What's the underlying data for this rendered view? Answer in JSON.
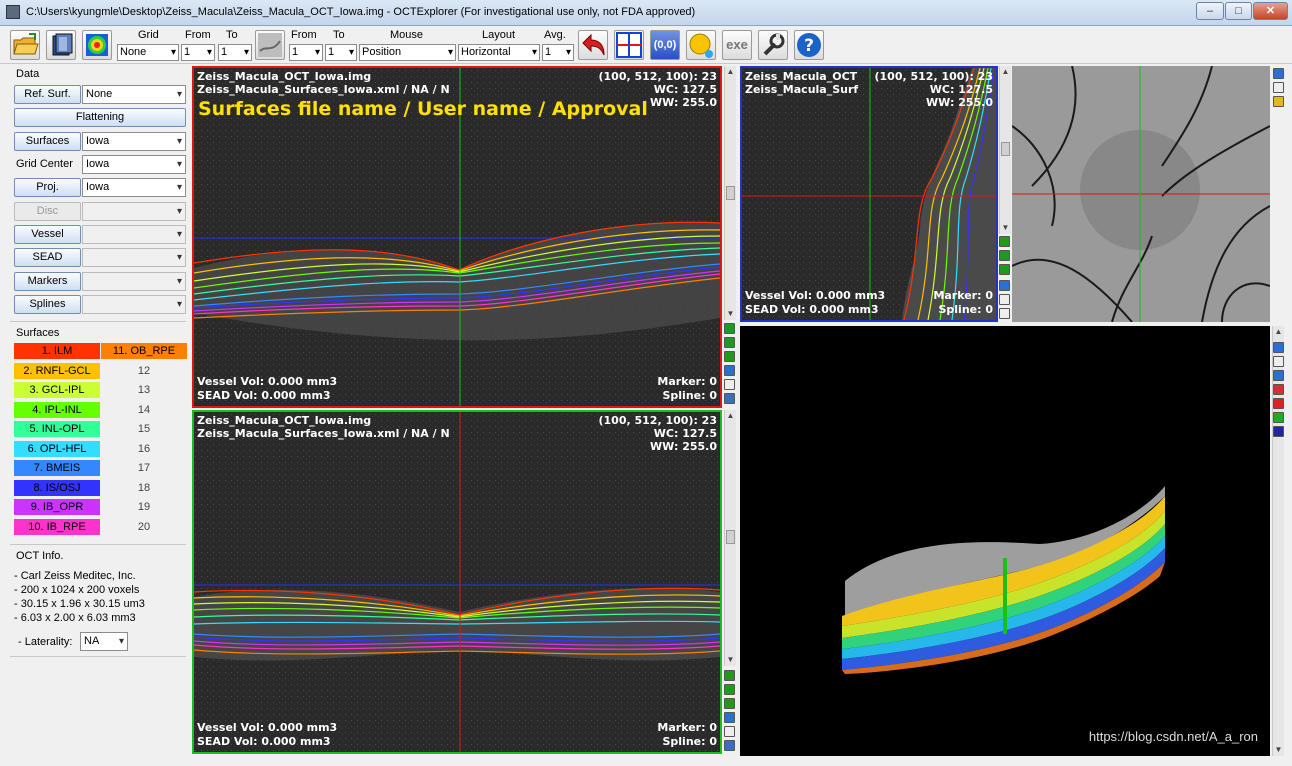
{
  "window": {
    "title": "C:\\Users\\kyungmle\\Desktop\\Zeiss_Macula\\Zeiss_Macula_OCT_Iowa.img - OCTExplorer (For investigational use only, not FDA approved)",
    "minimize": "‒",
    "maximize": "□",
    "close": "✕"
  },
  "toolbar": {
    "grid_label": "Grid",
    "grid_value": "None",
    "from1_label": "From",
    "from1_value": "1",
    "to1_label": "To",
    "to1_value": "1",
    "from2_label": "From",
    "from2_value": "1",
    "to2_label": "To",
    "to2_value": "1",
    "mouse_label": "Mouse",
    "mouse_value": "Position",
    "layout_label": "Layout",
    "layout_value": "Horizontal",
    "avg_label": "Avg.",
    "avg_value": "1",
    "coords_label": "(0,0)",
    "exe_label": "exe",
    "help_label": "?"
  },
  "sidebar": {
    "data_header": "Data",
    "ref_surf_btn": "Ref. Surf.",
    "ref_surf_value": "None",
    "flattening_btn": "Flattening",
    "surfaces_btn": "Surfaces",
    "surfaces_value": "Iowa",
    "grid_center_label": "Grid Center",
    "grid_center_value": "Iowa",
    "proj_btn": "Proj.",
    "proj_value": "Iowa",
    "disc_btn": "Disc",
    "vessel_btn": "Vessel",
    "sead_btn": "SEAD",
    "markers_btn": "Markers",
    "splines_btn": "Splines",
    "surfaces_header": "Surfaces",
    "surfaces_list": [
      {
        "label": "1. ILM",
        "color": "#ff3300"
      },
      {
        "label": "2. RNFL-GCL",
        "color": "#ffc000"
      },
      {
        "label": "3. GCL-IPL",
        "color": "#ccff33"
      },
      {
        "label": "4. IPL-INL",
        "color": "#66ff00"
      },
      {
        "label": "5. INL-OPL",
        "color": "#33ff99"
      },
      {
        "label": "6. OPL-HFL",
        "color": "#33ddff"
      },
      {
        "label": "7. BMEIS",
        "color": "#3388ff"
      },
      {
        "label": "8. IS/OSJ",
        "color": "#3333ff"
      },
      {
        "label": "9. IB_OPR",
        "color": "#cc33ff"
      },
      {
        "label": "10. IB_RPE",
        "color": "#ff33cc"
      }
    ],
    "surfaces_list2": [
      {
        "label": "11. OB_RPE",
        "color": "#ff8000"
      },
      {
        "label": "12"
      },
      {
        "label": "13"
      },
      {
        "label": "14"
      },
      {
        "label": "15"
      },
      {
        "label": "16"
      },
      {
        "label": "17"
      },
      {
        "label": "18"
      },
      {
        "label": "19"
      },
      {
        "label": "20"
      }
    ],
    "oct_info_header": "OCT Info.",
    "oct_info": [
      "- Carl Zeiss Meditec, Inc.",
      "- 200 x 1024 x 200 voxels",
      "- 30.15 x 1.96 x 30.15 um3",
      "- 6.03 x 2.00 x 6.03 mm3"
    ],
    "laterality_label": "- Laterality:",
    "laterality_value": "NA"
  },
  "panel_top": {
    "line1": "Zeiss_Macula_OCT_Iowa.img",
    "line2": "Zeiss_Macula_Surfaces_Iowa.xml / NA / N",
    "big_text": "Surfaces file name / User name / Approval",
    "coord": "(100, 512, 100): 23",
    "wc": "WC: 127.5",
    "ww": "WW: 255.0",
    "vessel": "Vessel Vol: 0.000 mm3",
    "sead": "SEAD Vol: 0.000 mm3",
    "marker": "Marker: 0",
    "spline": "Spline: 0"
  },
  "panel_bottom": {
    "line1": "Zeiss_Macula_OCT_Iowa.img",
    "line2": "Zeiss_Macula_Surfaces_Iowa.xml / NA / N",
    "coord": "(100, 512, 100): 23",
    "wc": "WC: 127.5",
    "ww": "WW: 255.0",
    "vessel": "Vessel Vol: 0.000 mm3",
    "sead": "SEAD Vol: 0.000 mm3",
    "marker": "Marker: 0",
    "spline": "Spline: 0"
  },
  "panel_side": {
    "line1": "Zeiss_Macula_OCT",
    "line2": "Zeiss_Macula_Surf",
    "coord": "(100, 512, 100): 23",
    "wc": "WC: 127.5",
    "ww": "WW: 255.0",
    "vessel": "Vessel Vol: 0.000 mm3",
    "sead": "SEAD Vol: 0.000 mm3",
    "marker": "Marker: 0",
    "spline": "Spline: 0"
  },
  "watermark": "https://blog.csdn.net/A_a_ron"
}
